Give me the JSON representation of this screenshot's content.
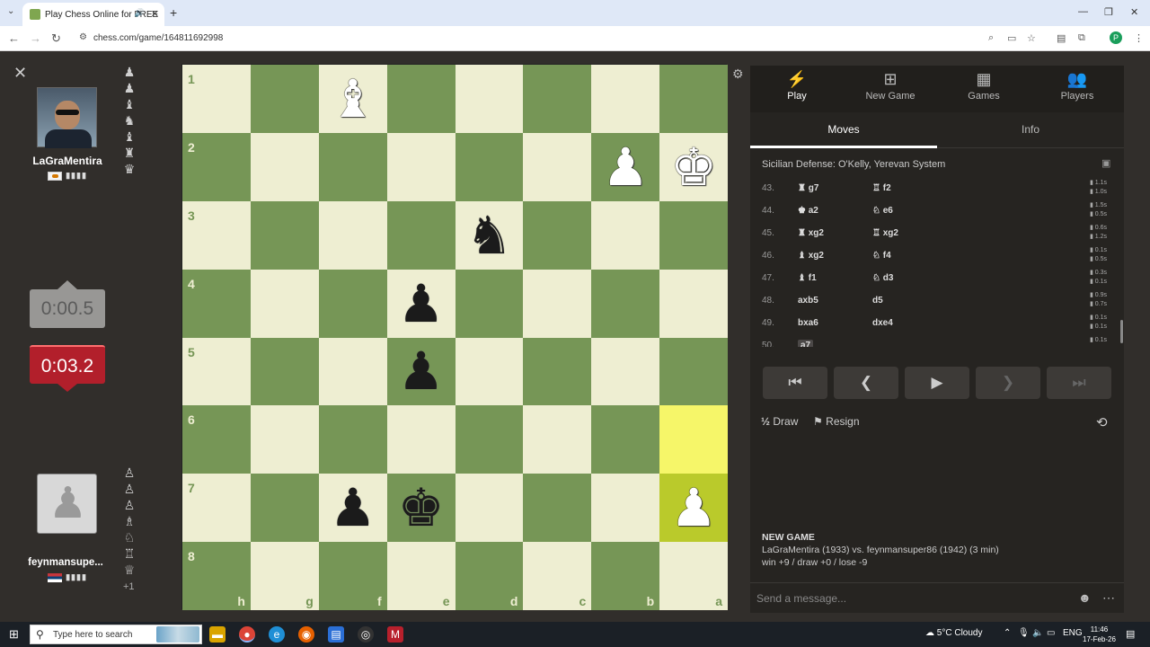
{
  "browser": {
    "tab_title": "Play Chess Online for FREE",
    "url": "chess.com/game/164811692998",
    "profile_initial": "P"
  },
  "left_panel": {
    "top_player": {
      "name": "LaGraMentira",
      "flag": "cyprus"
    },
    "bottom_player": {
      "name": "feynmansupe...",
      "flag": "serbia"
    },
    "top_clock": "0:00.5",
    "bottom_clock": "0:03.2",
    "bottom_material_diff": "+1"
  },
  "board": {
    "orientation": "black",
    "rank_labels": [
      "1",
      "2",
      "3",
      "4",
      "5",
      "6",
      "7",
      "8"
    ],
    "file_labels": [
      "h",
      "g",
      "f",
      "e",
      "d",
      "c",
      "b",
      "a"
    ],
    "highlight_squares": [
      "a6",
      "a7"
    ],
    "pieces": [
      {
        "square": "f1",
        "piece": "bishop",
        "color": "white"
      },
      {
        "square": "b2",
        "piece": "pawn",
        "color": "white"
      },
      {
        "square": "a2",
        "piece": "king",
        "color": "white"
      },
      {
        "square": "d3",
        "piece": "knight",
        "color": "black"
      },
      {
        "square": "e4",
        "piece": "pawn",
        "color": "black"
      },
      {
        "square": "e5",
        "piece": "pawn",
        "color": "black"
      },
      {
        "square": "f7",
        "piece": "pawn",
        "color": "black"
      },
      {
        "square": "e7",
        "piece": "king",
        "color": "black"
      },
      {
        "square": "a7",
        "piece": "pawn",
        "color": "white"
      }
    ]
  },
  "panel": {
    "tabs": [
      {
        "label": "Play",
        "icon": "lightning-icon"
      },
      {
        "label": "New Game",
        "icon": "plus-icon"
      },
      {
        "label": "Games",
        "icon": "board-icon"
      },
      {
        "label": "Players",
        "icon": "players-icon"
      }
    ],
    "subtabs": [
      "Moves",
      "Info"
    ],
    "opening": "Sicilian Defense: O'Kelly, Yerevan System",
    "moves": [
      {
        "num": "43.",
        "white": "g7",
        "white_piece": "rook",
        "black": "f2",
        "black_piece": "rook",
        "times": [
          "1.1s",
          "1.0s"
        ]
      },
      {
        "num": "44.",
        "white": "a2",
        "white_piece": "king",
        "black": "e6",
        "black_piece": "knight",
        "times": [
          "1.5s",
          "0.5s"
        ]
      },
      {
        "num": "45.",
        "white": "xg2",
        "white_piece": "rook",
        "black": "xg2",
        "black_piece": "rook",
        "times": [
          "0.6s",
          "1.2s"
        ]
      },
      {
        "num": "46.",
        "white": "xg2",
        "white_piece": "bishop",
        "black": "f4",
        "black_piece": "knight",
        "times": [
          "0.1s",
          "0.5s"
        ]
      },
      {
        "num": "47.",
        "white": "f1",
        "white_piece": "bishop",
        "black": "d3",
        "black_piece": "knight",
        "times": [
          "0.3s",
          "0.1s"
        ]
      },
      {
        "num": "48.",
        "white": "axb5",
        "white_piece": "",
        "black": "d5",
        "black_piece": "",
        "times": [
          "0.9s",
          "0.7s"
        ]
      },
      {
        "num": "49.",
        "white": "bxa6",
        "white_piece": "",
        "black": "dxe4",
        "black_piece": "",
        "times": [
          "0.1s",
          "0.1s"
        ]
      },
      {
        "num": "50.",
        "white": "a7",
        "white_piece": "",
        "black": "",
        "black_piece": "",
        "times": [
          "0.1s"
        ]
      }
    ],
    "draw_label": "Draw",
    "resign_label": "Resign",
    "new_game_header": "NEW GAME",
    "new_game_line1": "LaGraMentira (1933) vs. feynmansuper86 (1942) (3 min)",
    "new_game_line2": "win +9 / draw +0 / lose -9",
    "chat_placeholder": "Send a message..."
  },
  "taskbar": {
    "search_placeholder": "Type here to search",
    "weather": "5°C  Cloudy",
    "lang": "ENG",
    "time": "11:46",
    "date": "17-Feb-26"
  }
}
